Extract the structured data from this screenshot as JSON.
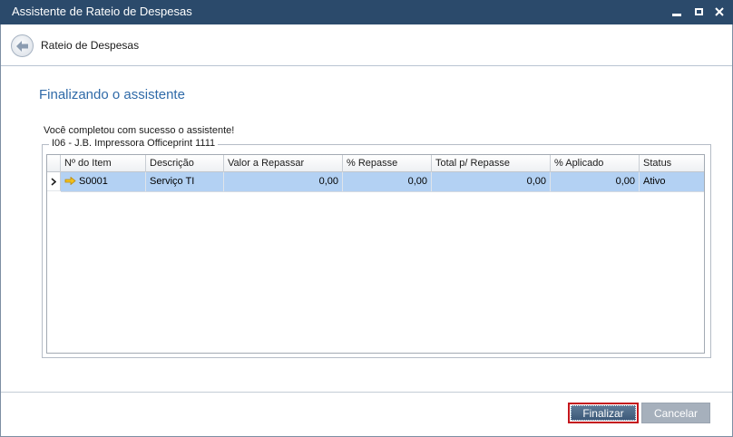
{
  "window": {
    "title": "Assistente de Rateio de Despesas",
    "controls": [
      "minimize-icon",
      "maximize-icon",
      "close-icon"
    ]
  },
  "header": {
    "back_icon": "back-arrow-icon",
    "title": "Rateio de Despesas"
  },
  "main": {
    "page_title": "Finalizando o assistente",
    "message": "Você completou com sucesso o assistente!",
    "group_label": "I06 - J.B. Impressora Officeprint 1111"
  },
  "grid": {
    "columns": [
      "Nº do Item",
      "Descrição",
      "Valor a Repassar",
      "% Repasse",
      "Total p/ Repasse",
      "% Aplicado",
      "Status"
    ],
    "rows": [
      {
        "row_indicator_icon": "row-pointer-icon",
        "item_icon": "link-arrow-icon",
        "item_no": "S0001",
        "descricao": "Serviço TI",
        "valor_a_repassar": "0,00",
        "pct_repasse": "0,00",
        "total_repasse": "0,00",
        "pct_aplicado": "0,00",
        "status": "Ativo"
      }
    ]
  },
  "footer": {
    "finalizar_label": "Finalizar",
    "cancelar_label": "Cancelar"
  },
  "colors": {
    "titlebar": "#2b4a6b",
    "accent_title": "#2f6aa8",
    "selected_row": "#b3d1f3",
    "focus_border": "#c4161c",
    "item_arrow": "#f2c11c"
  }
}
